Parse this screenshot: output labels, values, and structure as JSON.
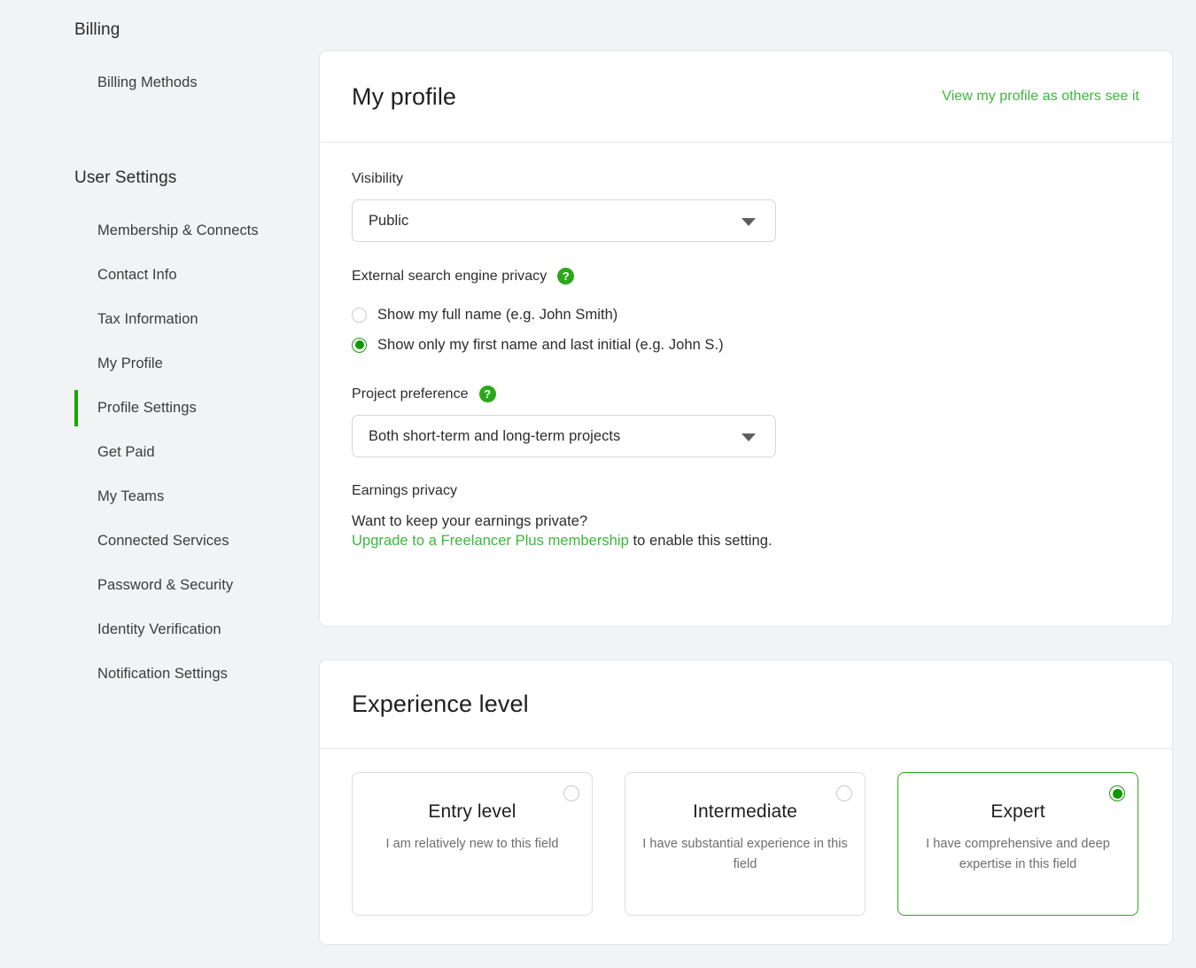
{
  "sidebar": {
    "groups": [
      {
        "title": "Billing",
        "items": [
          {
            "label": "Billing Methods",
            "active": false
          }
        ]
      },
      {
        "title": "User Settings",
        "items": [
          {
            "label": "Membership & Connects",
            "active": false
          },
          {
            "label": "Contact Info",
            "active": false
          },
          {
            "label": "Tax Information",
            "active": false
          },
          {
            "label": "My Profile",
            "active": false
          },
          {
            "label": "Profile Settings",
            "active": true
          },
          {
            "label": "Get Paid",
            "active": false
          },
          {
            "label": "My Teams",
            "active": false
          },
          {
            "label": "Connected Services",
            "active": false
          },
          {
            "label": "Password & Security",
            "active": false
          },
          {
            "label": "Identity Verification",
            "active": false
          },
          {
            "label": "Notification Settings",
            "active": false
          }
        ]
      }
    ]
  },
  "profile_card": {
    "title": "My profile",
    "view_link": "View my profile as others see it",
    "visibility": {
      "label": "Visibility",
      "value": "Public",
      "options": [
        "Public"
      ]
    },
    "search_privacy": {
      "label": "External search engine privacy",
      "help_icon": "question-mark-icon",
      "options": [
        {
          "label": "Show my full name (e.g. John Smith)",
          "selected": false
        },
        {
          "label": "Show only my first name and last initial (e.g. John S.)",
          "selected": true
        }
      ]
    },
    "project_preference": {
      "label": "Project preference",
      "help_icon": "question-mark-icon",
      "value": "Both short-term and long-term projects",
      "options": [
        "Both short-term and long-term projects"
      ]
    },
    "earnings_privacy": {
      "label": "Earnings privacy",
      "question": "Want to keep your earnings private?",
      "upgrade_link": "Upgrade to a Freelancer Plus membership",
      "suffix": " to enable this setting."
    }
  },
  "experience_card": {
    "title": "Experience level",
    "levels": [
      {
        "title": "Entry level",
        "description": "I am relatively new to this field",
        "selected": false
      },
      {
        "title": "Intermediate",
        "description": "I have substantial experience in this field",
        "selected": false
      },
      {
        "title": "Expert",
        "description": "I have comprehensive and deep expertise in this field",
        "selected": true
      }
    ]
  },
  "colors": {
    "accent_green": "#14a800",
    "link_green": "#3cb73c",
    "page_background": "#f2f3f4",
    "card_background": "#ffffff",
    "border": "#e4e5e7"
  }
}
